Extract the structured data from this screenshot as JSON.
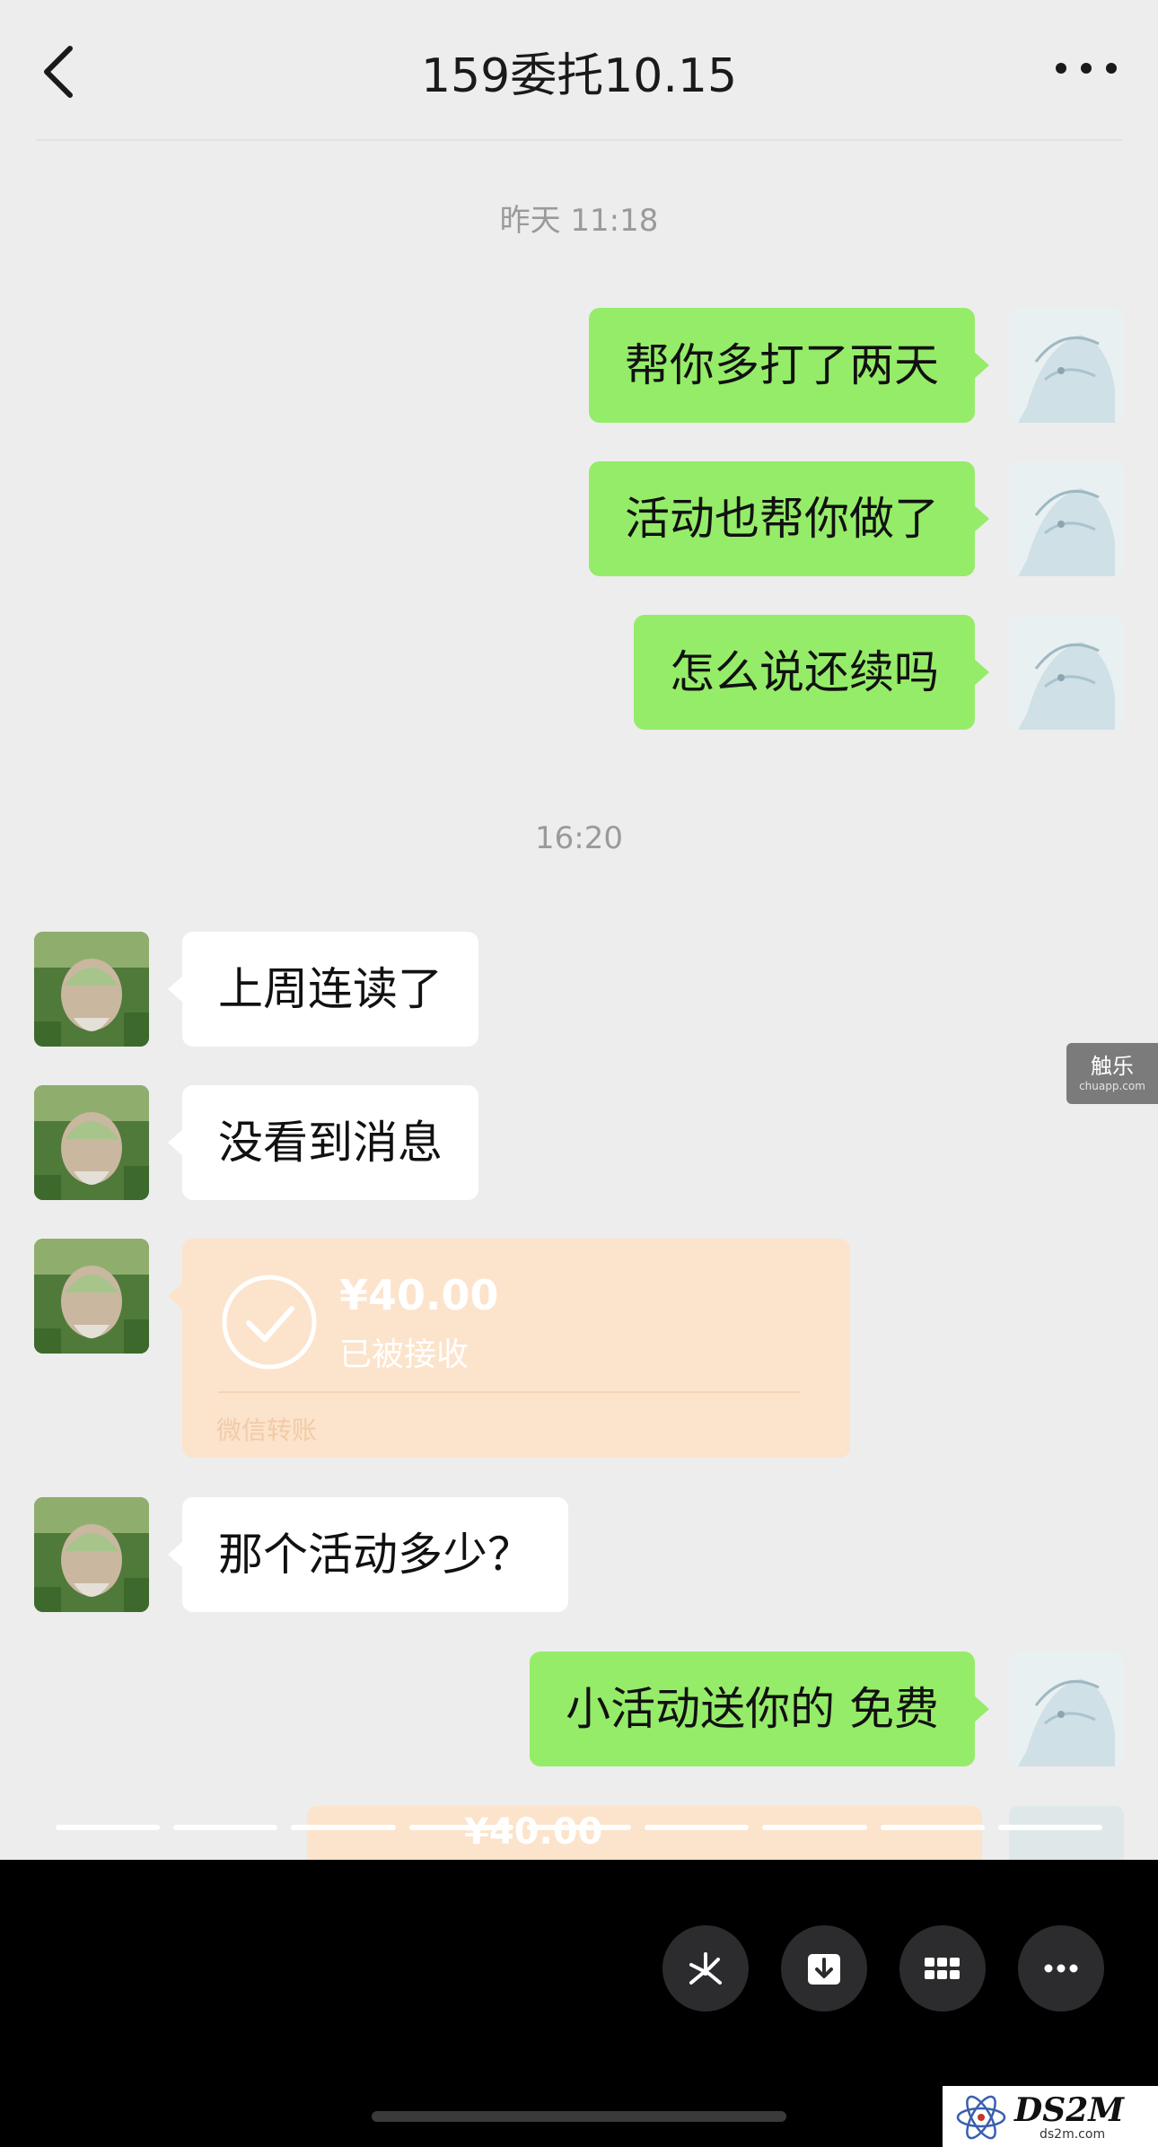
{
  "header": {
    "title": "159委托10.15"
  },
  "timestamps": [
    "昨天 11:18",
    "16:20"
  ],
  "messages": [
    {
      "side": "me",
      "text": "帮你多打了两天"
    },
    {
      "side": "me",
      "text": "活动也帮你做了"
    },
    {
      "side": "me",
      "text": "怎么说还续吗"
    },
    {
      "side": "them",
      "text": "上周连读了"
    },
    {
      "side": "them",
      "text": "没看到消息"
    },
    {
      "side": "them",
      "type": "transfer",
      "amount": "¥40.00",
      "status": "已被接收",
      "footer": "微信转账"
    },
    {
      "side": "them",
      "text": "那个活动多少？"
    },
    {
      "side": "me",
      "text": "小活动送你的  免费"
    }
  ],
  "peek_transfer": {
    "amount": "¥40.00"
  },
  "watermark": {
    "brand": "触乐",
    "domain": "chuapp.com"
  },
  "corner_logo": {
    "brand": "DS2M",
    "domain": "ds2m.com"
  },
  "bottom_actions": [
    "share-icon",
    "download-icon",
    "grid-icon",
    "more-icon"
  ],
  "colors": {
    "my_bubble": "#95ec69",
    "their_bubble": "#ffffff",
    "transfer_card": "#fce3cb",
    "chat_bg": "#ededed"
  }
}
